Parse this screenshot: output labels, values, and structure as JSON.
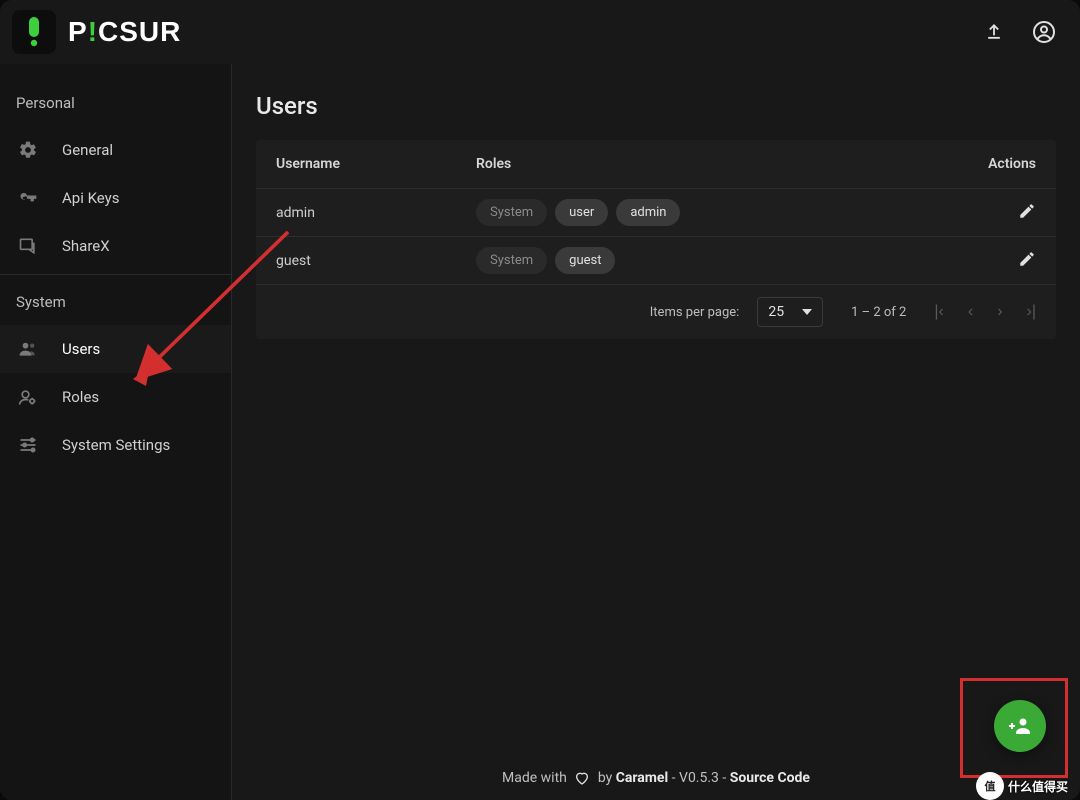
{
  "brand": {
    "name": "PICSUR"
  },
  "header": {
    "actions": {
      "upload": "upload",
      "account": "account"
    }
  },
  "sidebar": {
    "sections": [
      {
        "label": "Personal",
        "items": [
          {
            "icon": "gear-icon",
            "label": "General"
          },
          {
            "icon": "key-icon",
            "label": "Api Keys"
          },
          {
            "icon": "sharex-icon",
            "label": "ShareX"
          }
        ]
      },
      {
        "label": "System",
        "items": [
          {
            "icon": "users-icon",
            "label": "Users",
            "active": true
          },
          {
            "icon": "roles-icon",
            "label": "Roles"
          },
          {
            "icon": "tune-icon",
            "label": "System Settings"
          }
        ]
      }
    ]
  },
  "page": {
    "title": "Users"
  },
  "table": {
    "columns": {
      "username": "Username",
      "roles": "Roles",
      "actions": "Actions"
    },
    "rows": [
      {
        "username": "admin",
        "roles": [
          {
            "label": "System",
            "muted": true
          },
          {
            "label": "user",
            "muted": false
          },
          {
            "label": "admin",
            "muted": false
          }
        ]
      },
      {
        "username": "guest",
        "roles": [
          {
            "label": "System",
            "muted": true
          },
          {
            "label": "guest",
            "muted": false
          }
        ]
      }
    ]
  },
  "paginator": {
    "items_per_page_label": "Items per page:",
    "page_size": "25",
    "range_label": "1 – 2 of 2"
  },
  "footer": {
    "made_with": "Made with",
    "by": "by",
    "author": "Caramel",
    "version_prefix": "- V",
    "version": "0.5.3",
    "separator": " - ",
    "source": "Source Code"
  },
  "fab": {
    "label": "add-user"
  },
  "watermark": {
    "text": "什么值得买",
    "short": "值"
  }
}
